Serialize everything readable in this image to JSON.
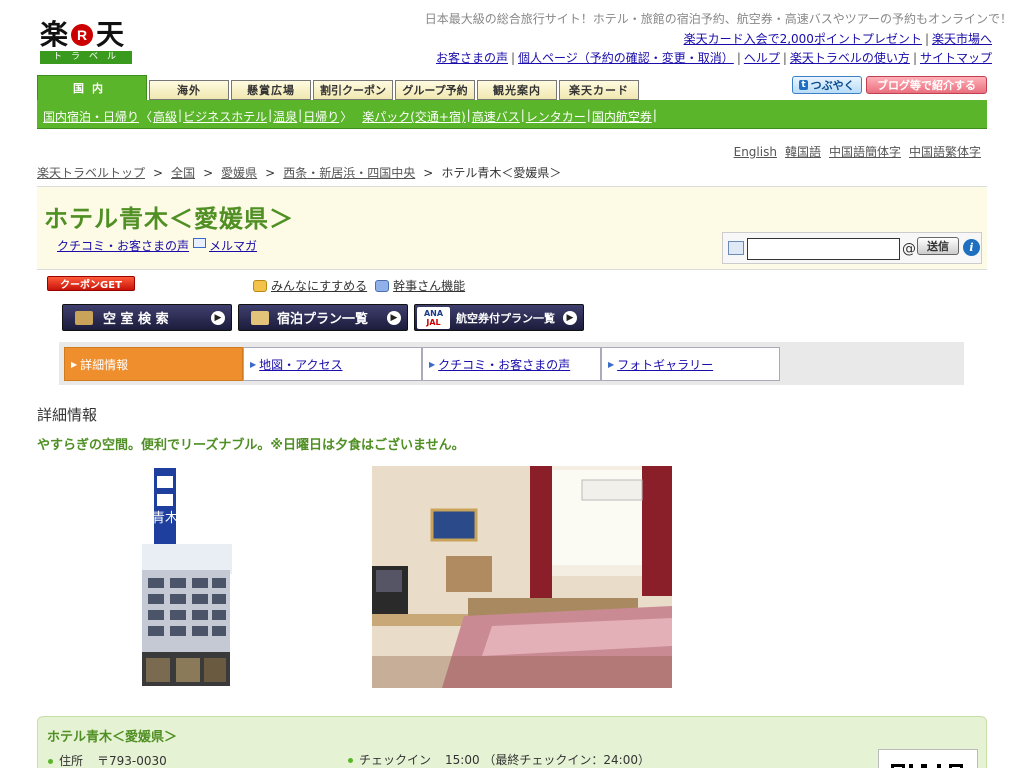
{
  "logo": {
    "main": "楽天",
    "sub": "トラベル"
  },
  "tagline": "日本最大級の総合旅行サイト！ホテル・旅館の宿泊予約、航空券・高速バスやツアーの予約もオンラインで！",
  "top_links_1": [
    "楽天カード入会で2,000ポイントプレゼント",
    "楽天市場へ"
  ],
  "top_links_2": [
    "お客さまの声",
    "個人ページ（予約の確認・変更・取消）",
    "ヘルプ",
    "楽天トラベルの使い方",
    "サイトマップ"
  ],
  "tabs": [
    "国内",
    "海外",
    "懸賞広場",
    "割引クーポン",
    "グループ予約",
    "観光案内",
    "楽天カード"
  ],
  "tweet_label": "つぶやく",
  "blog_label": "ブログ等で紹介する",
  "green_links": [
    "国内宿泊・日帰り",
    "高級",
    "ビジネスホテル",
    "温泉",
    "日帰り",
    "楽パック(交通+宿)",
    "高速バス",
    "レンタカー",
    "国内航空券"
  ],
  "languages": [
    "English",
    "韓国語",
    "中国語簡体字",
    "中国語繁体字"
  ],
  "breadcrumb": [
    "楽天トラベルトップ",
    "全国",
    "愛媛県",
    "西条・新居浜・四国中央",
    "ホテル青木＜愛媛県＞"
  ],
  "breadcrumb_sep": ">",
  "hotel": {
    "title": "ホテル青木＜愛媛県＞",
    "review_link": "クチコミ・お客さまの声",
    "mailmag_link": "メルマガ"
  },
  "search": {
    "value": "",
    "at": "@",
    "send": "送信",
    "info": "i"
  },
  "coupon_label": "クーポンGET",
  "recommend_link": "みんなにすすめる",
  "organizer_link": "幹事さん機能",
  "buttons": {
    "vacancy": "空 室 検 索",
    "plans": "宿泊プラン一覧",
    "air_plans": "航空券付プラン一覧",
    "ana": "ANA",
    "jal": "JAL"
  },
  "subnav": [
    "詳細情報",
    "地図・アクセス",
    "クチコミ・お客さまの声",
    "フォトギャラリー"
  ],
  "section_title": "詳細情報",
  "catch_copy": "やすらぎの空間。便利でリーズナブル。※日曜日は夕食はございません。",
  "building_sign": "青木",
  "info": {
    "title": "ホテル青木＜愛媛県＞",
    "address_label": "住所",
    "postal": "〒793-0030",
    "checkin_label": "チェックイン",
    "checkin_value": "15:00 （最終チェックイン：24:00）"
  },
  "colors": {
    "brand_green": "#5ab52a",
    "title_green": "#4f8f23",
    "active_orange": "#ef8e2c",
    "link_blue": "#1a0dab"
  }
}
